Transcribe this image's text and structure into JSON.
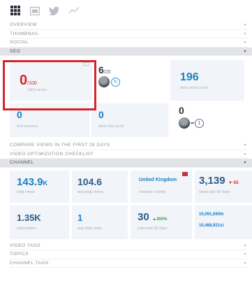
{
  "toolbar": {
    "icons": [
      "grid-icon",
      "calendar-icon",
      "twitter-icon",
      "trend-line-icon"
    ]
  },
  "sections_top": [
    {
      "label": "OVERVIEW",
      "chevron": "▾"
    },
    {
      "label": "THUMBNAIL",
      "chevron": "▾"
    },
    {
      "label": "SOCIAL",
      "chevron": "▾"
    },
    {
      "label": "SEO",
      "chevron": "▾"
    }
  ],
  "seo": {
    "score_value": "0",
    "score_max": "/100",
    "score_label": "SEO score",
    "tags_value": "6",
    "tags_max": "/20",
    "desc_words_value": "196",
    "desc_words_label": "desc word count",
    "end_screens_value": "0",
    "end_screens_label": "end screens",
    "desc_links_value": "0",
    "desc_links_label": "desc link count",
    "cards_value": "0",
    "cards_badge": "1"
  },
  "sections_mid": [
    {
      "label": "COMPARE VIEWS IN THE FIRST 28 DAYS",
      "chevron": "▾"
    },
    {
      "label": "VIDEO OPTIMIZATION CHECKLIST",
      "chevron": "▾"
    },
    {
      "label": "CHANNEL",
      "chevron": "▾"
    }
  ],
  "channel": {
    "total_views_value": "143.9",
    "total_views_unit": "K",
    "total_views_label": "total views",
    "avg_daily_views_value": "104.6",
    "avg_daily_views_label": "avg daily views",
    "country_value": "United Kingdom",
    "country_label": "channel country",
    "views_30_value": "3,139",
    "views_30_change": "▼-55",
    "views_30_label": "views last 30 days",
    "subscribers_value": "1.35K",
    "subscribers_label": "subscribers",
    "avg_daily_subs_value": "1",
    "avg_daily_subs_label": "avg daily subs",
    "subs_30_value": "30",
    "subs_30_change": "▲200%",
    "subs_30_label": "subs last 30 days",
    "rank_a": "10,091,690th",
    "rank_b": "10,488,921st"
  },
  "sections_bottom": [
    {
      "label": "VIDEO TAGS",
      "chevron": "▾"
    },
    {
      "label": "TOPICS",
      "chevron": "▾"
    },
    {
      "label": "CHANNEL TAGS",
      "chevron": "▾"
    }
  ],
  "colors": {
    "accent": "#1c80c4",
    "highlight": "#d3262c",
    "card_bg": "#f1f4f8"
  }
}
